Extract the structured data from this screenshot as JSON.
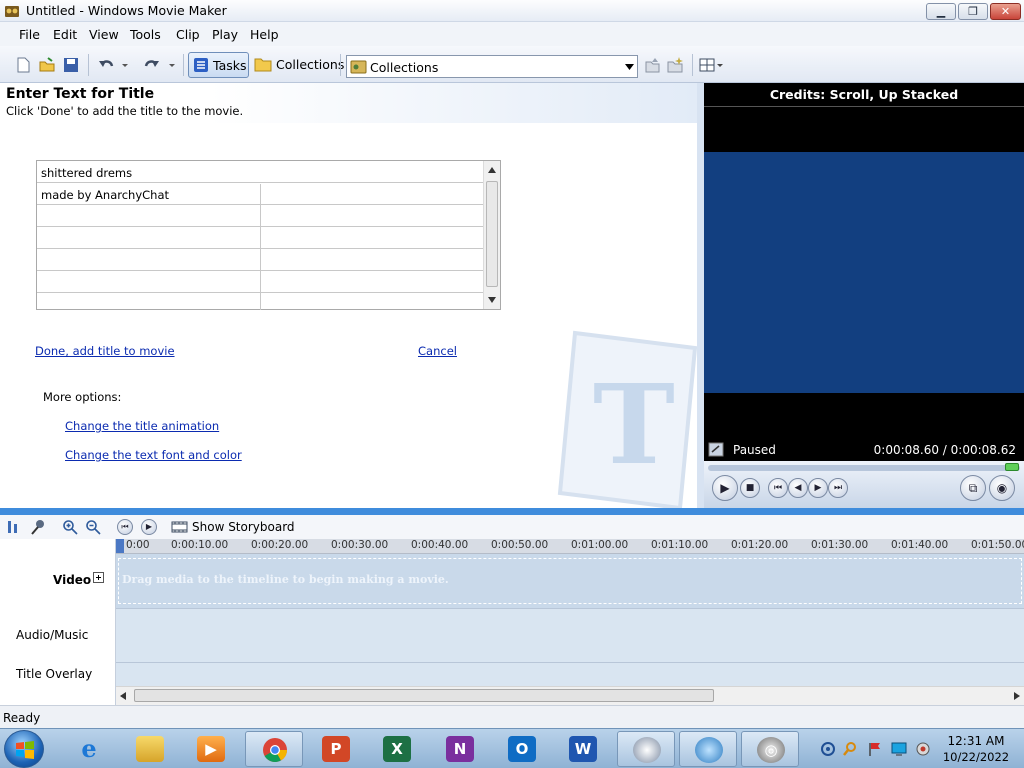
{
  "window": {
    "title": "Untitled - Windows Movie Maker"
  },
  "menu": [
    "File",
    "Edit",
    "View",
    "Tools",
    "Clip",
    "Play",
    "Help"
  ],
  "toolbar": {
    "tasks_label": "Tasks",
    "collections_label": "Collections",
    "collection_select": "Collections"
  },
  "task_pane": {
    "title": "Enter Text for Title",
    "subtitle": "Click 'Done' to add the title to the movie.",
    "title_line": "shittered drems",
    "credit_line": "made by AnarchyChat",
    "done_link": "Done, add title to movie",
    "cancel_link": "Cancel",
    "more_options": "More options:",
    "animation_link": "Change the title animation",
    "font_link": "Change the text font and color"
  },
  "preview": {
    "title": "Credits: Scroll, Up Stacked",
    "status": "Paused",
    "time": "0:00:08.60 / 0:00:08.62"
  },
  "timeline": {
    "storyboard_label": "Show Storyboard",
    "tracks": {
      "video": "Video",
      "audio": "Audio/Music",
      "title": "Title Overlay"
    },
    "video_hint": "Drag media to the timeline to begin making a movie.",
    "ruler": [
      "0:00",
      "0:00:10.00",
      "0:00:20.00",
      "0:00:30.00",
      "0:00:40.00",
      "0:00:50.00",
      "0:01:00.00",
      "0:01:10.00",
      "0:01:20.00",
      "0:01:30.00",
      "0:01:40.00",
      "0:01:50.00"
    ]
  },
  "statusbar": {
    "text": "Ready"
  },
  "taskbar": {
    "time": "12:31 AM",
    "date": "10/22/2022",
    "apps": [
      "internet-explorer-icon",
      "file-explorer-icon",
      "media-player-icon",
      "chrome-icon",
      "powerpoint-icon",
      "excel-icon",
      "onenote-icon",
      "outlook-icon",
      "word-icon",
      "app-icon",
      "app-icon",
      "movie-maker-icon"
    ]
  },
  "colors": {
    "preview_screen": "#123f80",
    "link": "#0b2bb0",
    "splitter": "#3f8cdc"
  }
}
